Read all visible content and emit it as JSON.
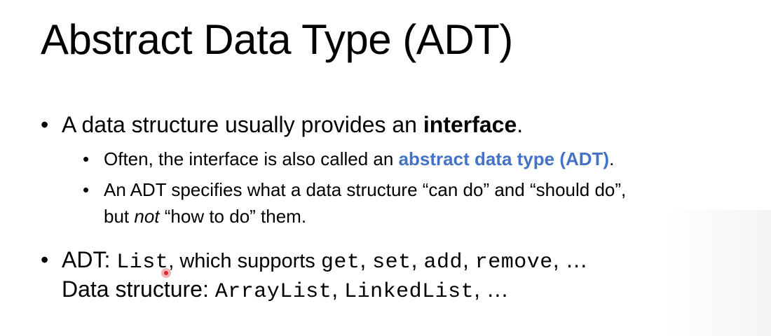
{
  "title": "Abstract Data Type (ADT)",
  "bullet_glyph": "•",
  "bullets": [
    {
      "text_before": "A data structure usually provides an ",
      "bold": "interface",
      "text_after": "."
    },
    {
      "text_before": "Often, the interface is also called an ",
      "accent": "abstract data type (ADT)",
      "text_after": ".",
      "accent_color": "#4472c4"
    },
    {
      "line1": "An ADT specifies what a data structure “can do” and “should do”,",
      "line2_before": "but ",
      "line2_italic": "not",
      "line2_after": " “how to do” them."
    },
    {
      "line1_label": "ADT: ",
      "line1_code1": "List",
      "line1_text": ", which supports ",
      "line1_code2": "get",
      "sep1": ", ",
      "line1_code3": "set",
      "sep2": ", ",
      "line1_code4": "add",
      "sep3": ", ",
      "line1_code5": "remove",
      "line1_end": ", …",
      "line2_label": "Data structure: ",
      "line2_code1": "ArrayList",
      "line2_sep": ", ",
      "line2_code2": "LinkedList",
      "line2_end": ", …"
    }
  ],
  "cursor_icon": "pointer-dot-icon"
}
